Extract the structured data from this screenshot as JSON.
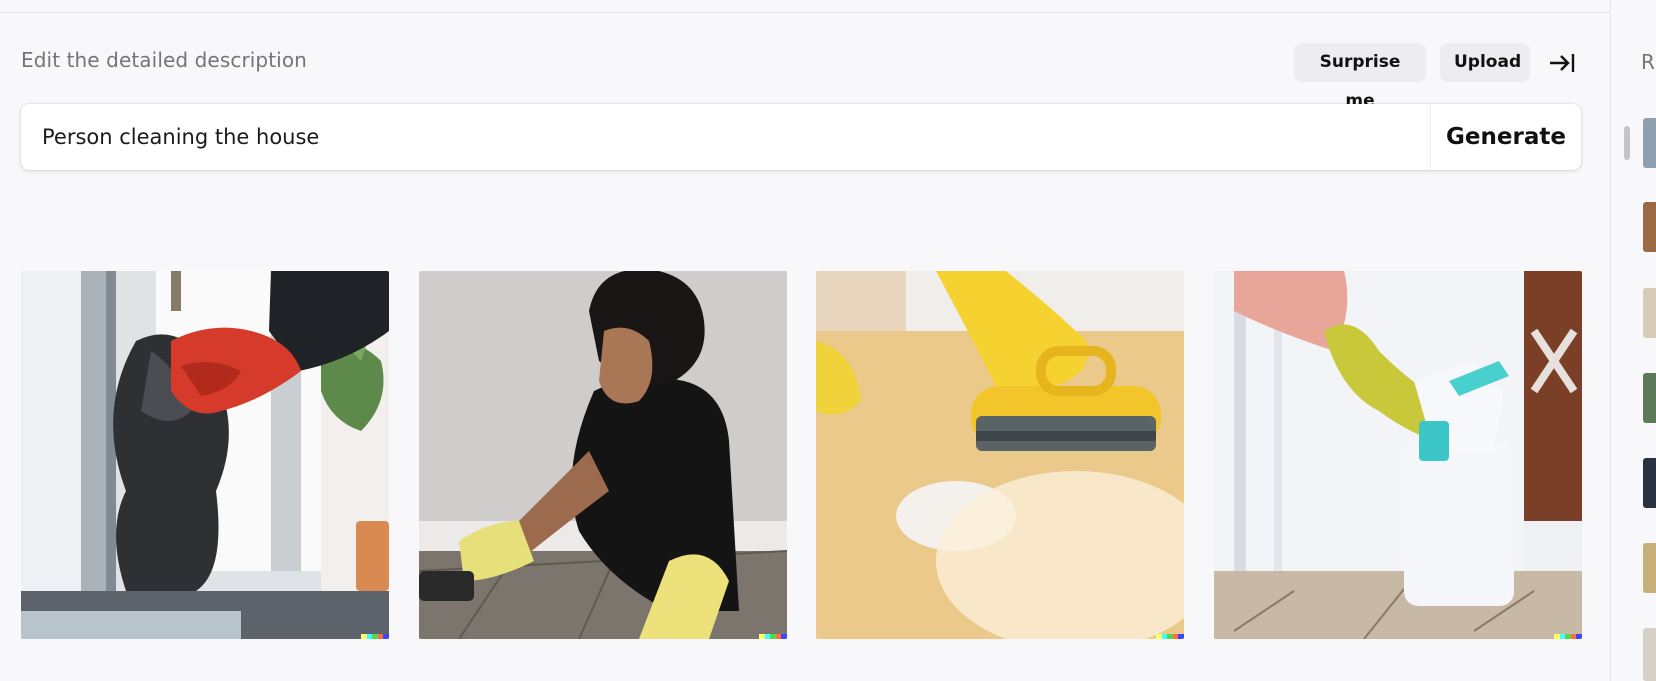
{
  "header": {
    "title": "Edit the detailed description",
    "surprise_label": "Surprise me",
    "upload_label": "Upload",
    "collapse_icon": "collapse-right-icon"
  },
  "prompt": {
    "value": "Person cleaning the house",
    "generate_label": "Generate"
  },
  "images": [
    {
      "alt": "gloved hand wiping window with dark cloth"
    },
    {
      "alt": "man scrubbing floor"
    },
    {
      "alt": "yellow scrub brush on countertop"
    },
    {
      "alt": "gloved hand with spray bottle"
    }
  ],
  "history": {
    "label": "R"
  },
  "colors": {
    "background": "#f8f8fa",
    "button_bg": "#ececf1",
    "muted_text": "#74747b"
  }
}
